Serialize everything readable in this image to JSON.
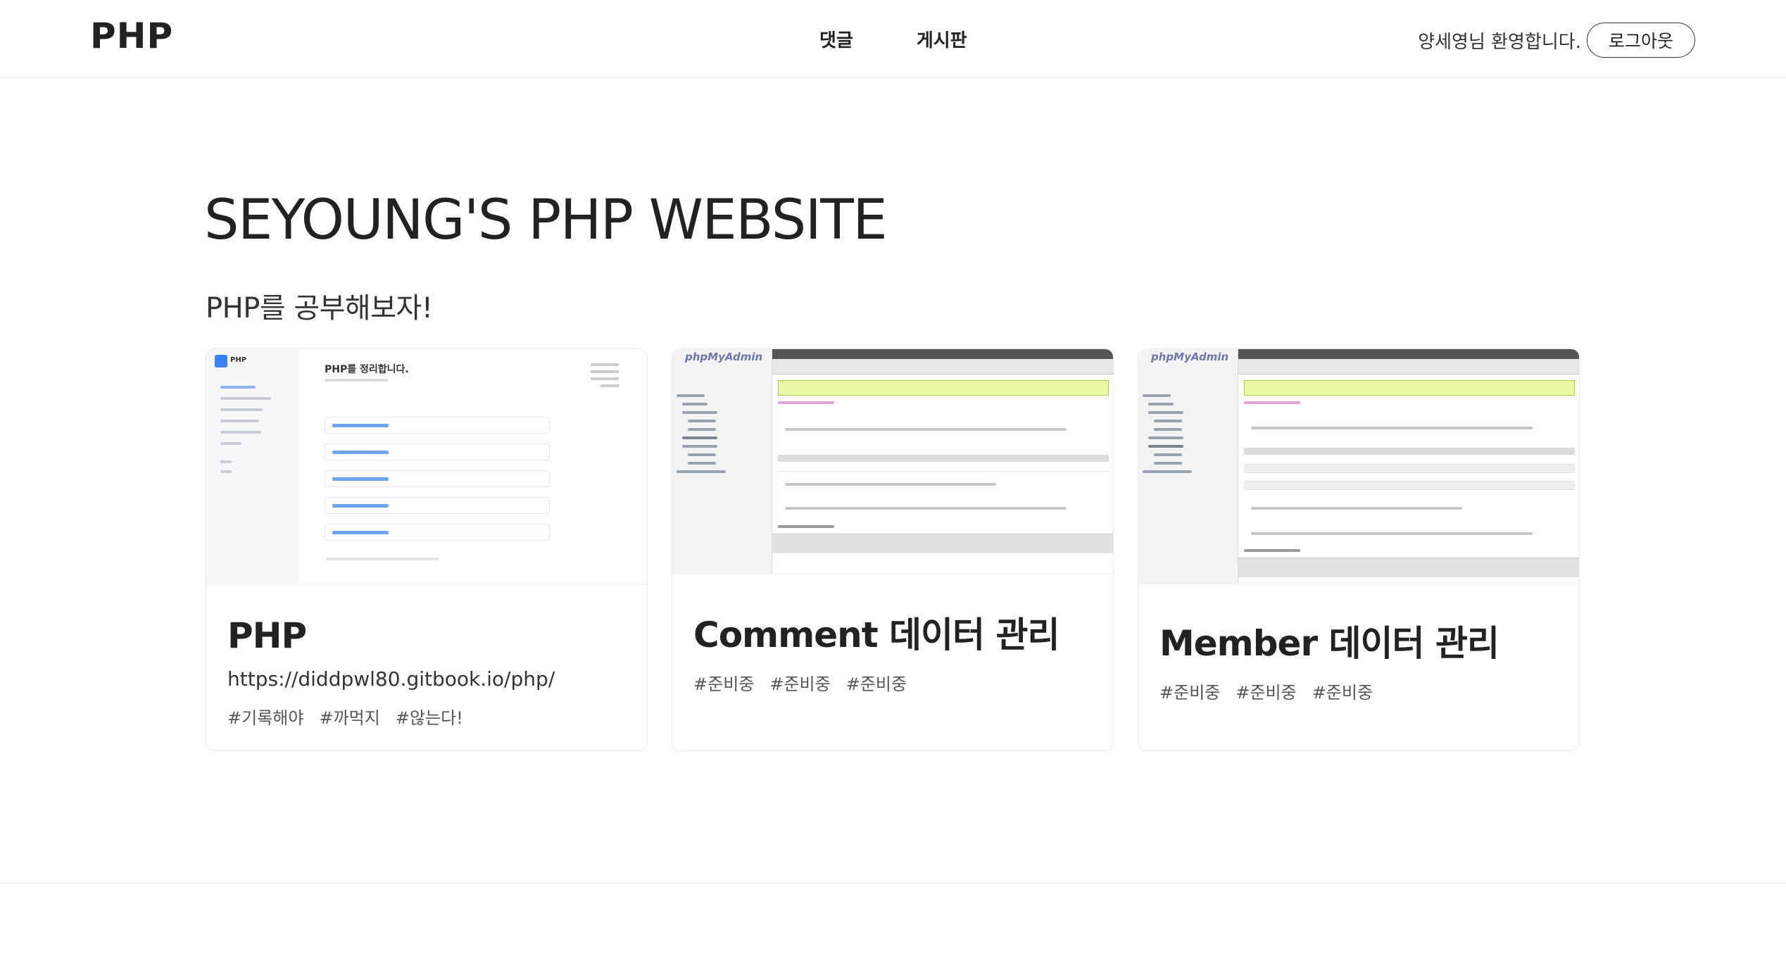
{
  "header": {
    "logo": "PHP",
    "nav": [
      "댓글",
      "게시판"
    ],
    "welcome": "양세영님 환영합니다.",
    "logout": "로그아웃"
  },
  "main": {
    "title": "SEYOUNG'S PHP WEBSITE",
    "subtitle": "PHP를 공부해보자!"
  },
  "cards": [
    {
      "title": "PHP",
      "link": "https://diddpwl80.gitbook.io/php/",
      "tags": [
        "#기록해야",
        "#까먹지",
        "#않는다!"
      ],
      "thumb": {
        "logo": "PHP",
        "heading": "PHP를 정리합니다."
      }
    },
    {
      "title": "Comment 데이터 관리",
      "tags": [
        "#준비중",
        "#준비중",
        "#준비중"
      ],
      "thumb": {
        "logo": "phpMyAdmin"
      }
    },
    {
      "title": "Member 데이터 관리",
      "tags": [
        "#준비중",
        "#준비중",
        "#준비중"
      ],
      "thumb": {
        "logo": "phpMyAdmin"
      }
    }
  ]
}
